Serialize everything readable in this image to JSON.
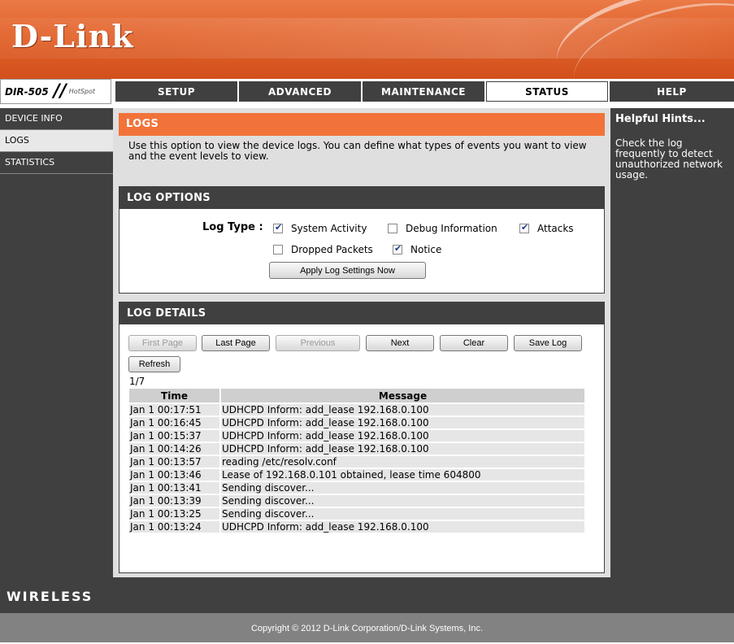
{
  "brand": {
    "logo": "D-Link",
    "model": "DIR-505",
    "model_tag": "HotSpot"
  },
  "nav": {
    "tabs": [
      {
        "label": "SETUP"
      },
      {
        "label": "ADVANCED"
      },
      {
        "label": "MAINTENANCE"
      },
      {
        "label": "STATUS",
        "active": true
      },
      {
        "label": "HELP"
      }
    ]
  },
  "sidebar": {
    "items": [
      {
        "label": "DEVICE INFO"
      },
      {
        "label": "LOGS",
        "active": true
      },
      {
        "label": "STATISTICS"
      }
    ]
  },
  "logs": {
    "title": "LOGS",
    "description": "Use this option to view the device logs. You can define what types of events you want to view and the event levels to view."
  },
  "log_options": {
    "title": "LOG OPTIONS",
    "log_type_label": "Log Type :",
    "types": [
      {
        "label": "System Activity",
        "checked": true
      },
      {
        "label": "Debug Information",
        "checked": false
      },
      {
        "label": "Attacks",
        "checked": true
      },
      {
        "label": "Dropped Packets",
        "checked": false
      },
      {
        "label": "Notice",
        "checked": true
      }
    ],
    "apply_label": "Apply Log Settings Now"
  },
  "log_details": {
    "title": "LOG DETAILS",
    "buttons": {
      "first_page": "First Page",
      "last_page": "Last Page",
      "previous": "Previous",
      "next": "Next",
      "clear": "Clear",
      "save_log": "Save Log",
      "refresh": "Refresh"
    },
    "page_indicator": "1/7",
    "columns": {
      "time": "Time",
      "message": "Message"
    },
    "rows": [
      {
        "time": "Jan 1 00:17:51",
        "message": "UDHCPD Inform: add_lease 192.168.0.100"
      },
      {
        "time": "Jan 1 00:16:45",
        "message": "UDHCPD Inform: add_lease 192.168.0.100"
      },
      {
        "time": "Jan 1 00:15:37",
        "message": "UDHCPD Inform: add_lease 192.168.0.100"
      },
      {
        "time": "Jan 1 00:14:26",
        "message": "UDHCPD Inform: add_lease 192.168.0.100"
      },
      {
        "time": "Jan 1 00:13:57",
        "message": "reading /etc/resolv.conf"
      },
      {
        "time": "Jan 1 00:13:46",
        "message": "Lease of 192.168.0.101 obtained, lease time 604800"
      },
      {
        "time": "Jan 1 00:13:41",
        "message": "Sending discover..."
      },
      {
        "time": "Jan 1 00:13:39",
        "message": "Sending discover..."
      },
      {
        "time": "Jan 1 00:13:25",
        "message": "Sending discover..."
      },
      {
        "time": "Jan 1 00:13:24",
        "message": "UDHCPD Inform: add_lease 192.168.0.100"
      }
    ]
  },
  "help": {
    "title": "Helpful Hints...",
    "text": "Check the log frequently to detect unauthorized network usage."
  },
  "footer": {
    "wireless": "WIRELESS",
    "copyright": "Copyright © 2012 D-Link Corporation/D-Link Systems, Inc."
  },
  "colors": {
    "accent": "#f1733a",
    "dark": "#404040",
    "panel": "#dfdfdf"
  }
}
